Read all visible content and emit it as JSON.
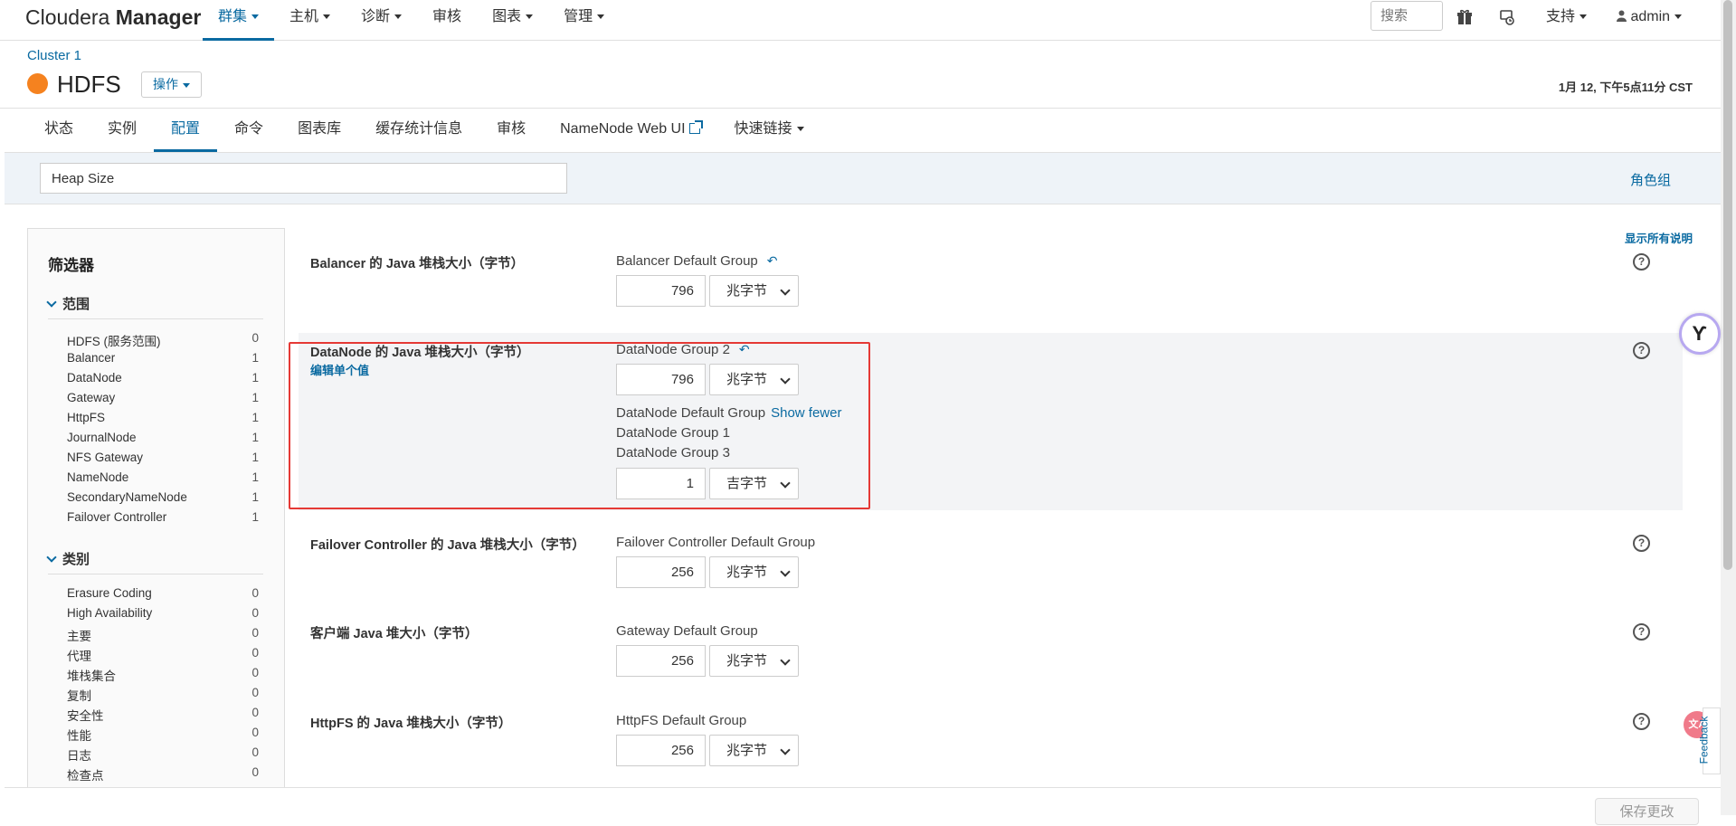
{
  "brand": {
    "prefix": "Cloudera",
    "suffix": "Manager"
  },
  "nav": [
    {
      "label": "群集",
      "dropdown": true,
      "active": true
    },
    {
      "label": "主机",
      "dropdown": true
    },
    {
      "label": "诊断",
      "dropdown": true
    },
    {
      "label": "审核",
      "dropdown": false
    },
    {
      "label": "图表",
      "dropdown": true
    },
    {
      "label": "管理",
      "dropdown": true
    }
  ],
  "top_search_placeholder": "搜索",
  "support_label": "支持",
  "user_label": "admin",
  "breadcrumb": "Cluster 1",
  "service": {
    "name": "HDFS",
    "status_color": "#f5821f",
    "ops_label": "操作"
  },
  "datetime": "1月 12, 下午5点11分 CST",
  "tabs": [
    {
      "label": "状态"
    },
    {
      "label": "实例"
    },
    {
      "label": "配置",
      "active": true
    },
    {
      "label": "命令"
    },
    {
      "label": "图表库"
    },
    {
      "label": "缓存统计信息"
    },
    {
      "label": "审核"
    },
    {
      "label": "NameNode Web UI",
      "external": true
    },
    {
      "label": "快速链接",
      "dropdown": true
    }
  ],
  "config_search_value": "Heap Size",
  "role_group_label": "角色组",
  "show_all_label": "显示所有说明",
  "sidebar": {
    "title": "筛选器",
    "scope": {
      "label": "范围",
      "items": [
        {
          "name": "HDFS (服务范围)",
          "count": "0"
        },
        {
          "name": "Balancer",
          "count": "1"
        },
        {
          "name": "DataNode",
          "count": "1"
        },
        {
          "name": "Gateway",
          "count": "1"
        },
        {
          "name": "HttpFS",
          "count": "1"
        },
        {
          "name": "JournalNode",
          "count": "1"
        },
        {
          "name": "NFS Gateway",
          "count": "1"
        },
        {
          "name": "NameNode",
          "count": "1"
        },
        {
          "name": "SecondaryNameNode",
          "count": "1"
        },
        {
          "name": "Failover Controller",
          "count": "1"
        }
      ]
    },
    "category": {
      "label": "类别",
      "items": [
        {
          "name": "Erasure Coding",
          "count": "0"
        },
        {
          "name": "High Availability",
          "count": "0"
        },
        {
          "name": "主要",
          "count": "0"
        },
        {
          "name": "代理",
          "count": "0"
        },
        {
          "name": "堆栈集合",
          "count": "0"
        },
        {
          "name": "复制",
          "count": "0"
        },
        {
          "name": "安全性",
          "count": "0"
        },
        {
          "name": "性能",
          "count": "0"
        },
        {
          "name": "日志",
          "count": "0"
        },
        {
          "name": "检查点",
          "count": "0"
        }
      ]
    }
  },
  "configs": {
    "balancer": {
      "label": "Balancer 的 Java 堆栈大小（字节）",
      "group": "Balancer Default Group",
      "value": "796",
      "unit": "兆字节"
    },
    "datanode": {
      "label": "DataNode 的 Java 堆栈大小（字节）",
      "edit_link": "编辑单个值",
      "group": "DataNode Group 2",
      "value": "796",
      "unit": "兆字节",
      "group2": "DataNode Default Group",
      "show_fewer": "Show fewer",
      "group3": "DataNode Group 1",
      "group4": "DataNode Group 3",
      "value2": "1",
      "unit2": "吉字节"
    },
    "failover": {
      "label": "Failover Controller 的 Java 堆栈大小（字节）",
      "group": "Failover Controller Default Group",
      "value": "256",
      "unit": "兆字节"
    },
    "client": {
      "label": "客户端 Java 堆大小（字节）",
      "group": "Gateway Default Group",
      "value": "256",
      "unit": "兆字节"
    },
    "httpfs": {
      "label": "HttpFS 的 Java 堆栈大小（字节）",
      "group": "HttpFS Default Group",
      "value": "256",
      "unit": "兆字节"
    }
  },
  "help_glyph": "?",
  "save_label": "保存更改",
  "feedback_label": "Feedback",
  "translate_label": "文A"
}
